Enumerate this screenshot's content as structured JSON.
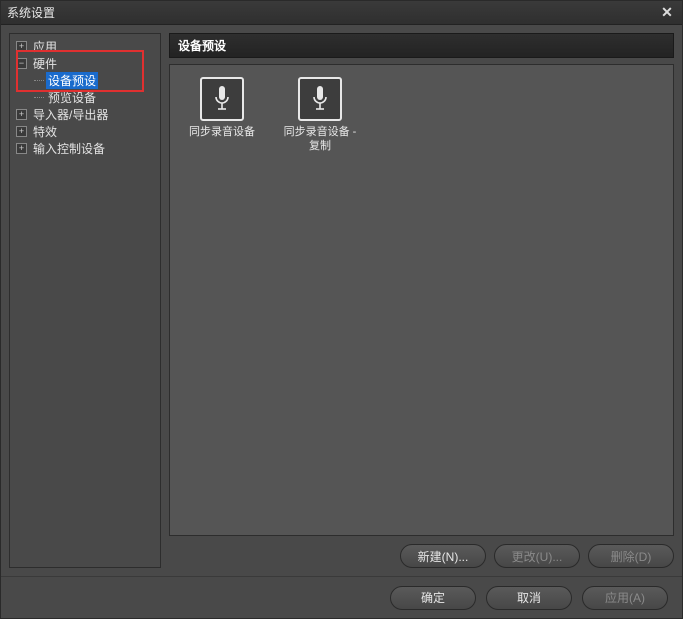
{
  "window": {
    "title": "系统设置"
  },
  "sidebar": {
    "items": [
      {
        "label": "应用"
      },
      {
        "label": "硬件"
      },
      {
        "label": "设备预设"
      },
      {
        "label": "预览设备"
      },
      {
        "label": "导入器/导出器"
      },
      {
        "label": "特效"
      },
      {
        "label": "输入控制设备"
      }
    ]
  },
  "panel": {
    "title": "设备预设"
  },
  "presets": [
    {
      "label": "同步录音设备"
    },
    {
      "label": "同步录音设备 - 复制"
    }
  ],
  "buttons": {
    "new": "新建(N)...",
    "change": "更改(U)...",
    "delete": "删除(D)",
    "ok": "确定",
    "cancel": "取消",
    "apply": "应用(A)"
  }
}
